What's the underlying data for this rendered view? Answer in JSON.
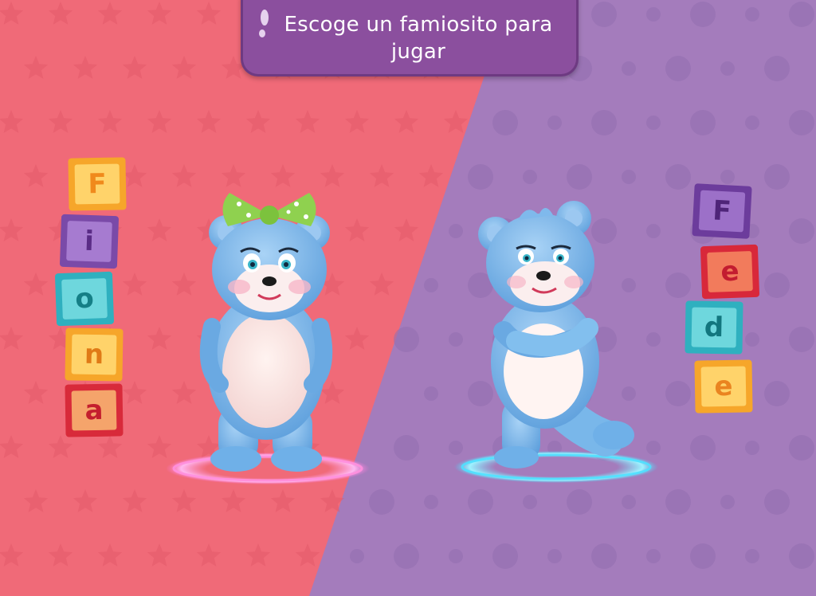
{
  "header": {
    "prompt": "Escoge un famiosito para jugar"
  },
  "characters": [
    {
      "id": "fiona",
      "letters": [
        "F",
        "i",
        "o",
        "n",
        "a"
      ]
    },
    {
      "id": "fede",
      "letters": [
        "F",
        "e",
        "d",
        "e"
      ]
    }
  ],
  "colors": {
    "left_background": "#f06a78",
    "right_background": "#a47cbc",
    "banner": "#8b4f9e",
    "bear_fur": "#7fb9ec",
    "bow": "#8fd14f"
  },
  "icons": [
    "speech-dots-icon",
    "bear-fiona-figure",
    "bear-fede-figure"
  ]
}
